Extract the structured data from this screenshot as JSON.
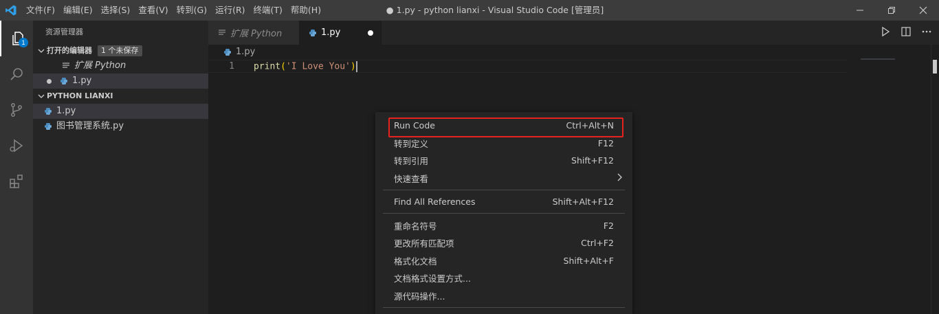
{
  "titlebar": {
    "menus": [
      "文件(F)",
      "编辑(E)",
      "选择(S)",
      "查看(V)",
      "转到(G)",
      "运行(R)",
      "终端(T)",
      "帮助(H)"
    ],
    "title": "● 1.py - python lianxi - Visual Studio Code [管理员]"
  },
  "activity": {
    "explorer_badge": "1"
  },
  "sidebar": {
    "title": "资源管理器",
    "open_editors": {
      "header": "打开的编辑器",
      "badge": "1 个未保存",
      "items": [
        "扩展 Python",
        "1.py"
      ]
    },
    "folder": {
      "header": "PYTHON LIANXI",
      "files": [
        "1.py",
        "图书管理系统.py"
      ]
    }
  },
  "editor": {
    "tabs": [
      {
        "label": "扩展 Python",
        "active": false
      },
      {
        "label": "1.py",
        "active": true,
        "dirty": true
      }
    ],
    "breadcrumb": "1.py",
    "lines": [
      {
        "number": "1",
        "fn": "print",
        "open": "(",
        "str": "'I Love You'",
        "close": ")"
      }
    ]
  },
  "context_menu": {
    "items": [
      {
        "label": "Run Code",
        "shortcut": "Ctrl+Alt+N",
        "highlight": true
      },
      {
        "label": "转到定义",
        "shortcut": "F12"
      },
      {
        "label": "转到引用",
        "shortcut": "Shift+F12"
      },
      {
        "label": "快速查看",
        "submenu": true
      },
      {
        "label": "Find All References",
        "shortcut": "Shift+Alt+F12"
      },
      {
        "label": "重命名符号",
        "shortcut": "F2"
      },
      {
        "label": "更改所有匹配项",
        "shortcut": "Ctrl+F2"
      },
      {
        "label": "格式化文档",
        "shortcut": "Shift+Alt+F"
      },
      {
        "label": "文档格式设置方式..."
      },
      {
        "label": "源代码操作..."
      }
    ],
    "highlight_color": "#e8231f"
  },
  "colors": {
    "accent": "#007acc",
    "titlebar": "#3c3c3c",
    "sidebar": "#252526",
    "editor": "#1e1e1e"
  }
}
